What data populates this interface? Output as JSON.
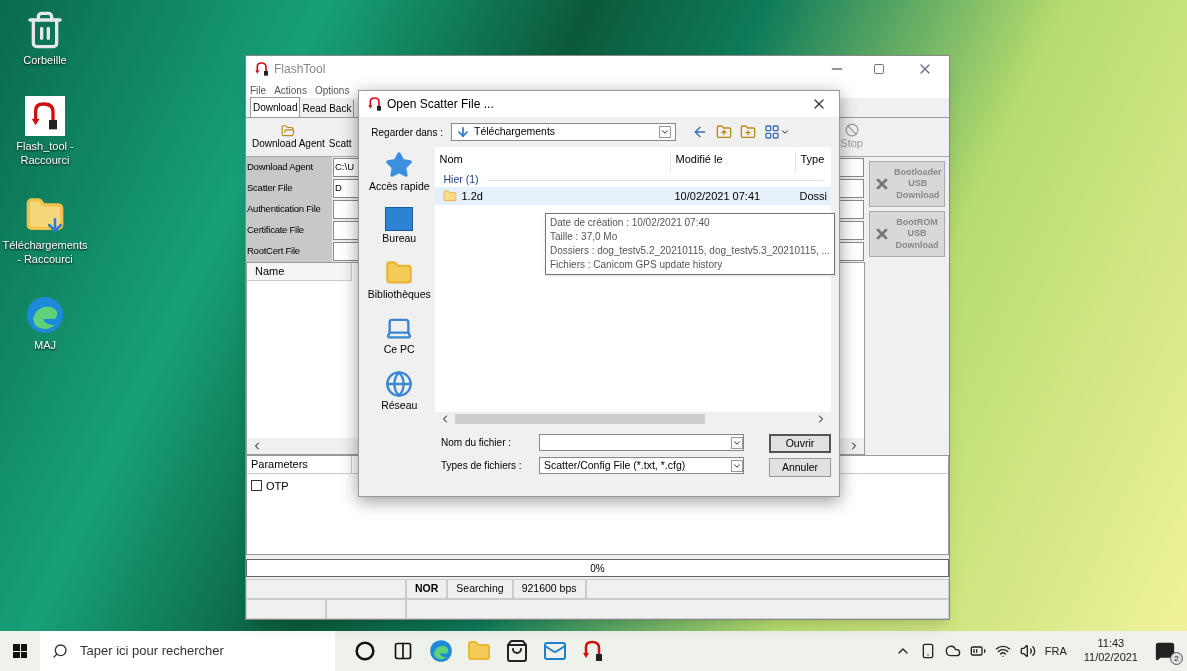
{
  "desktop_icons": [
    {
      "kind": "recycle_bin",
      "label": "Corbeille"
    },
    {
      "kind": "flash",
      "label": "Flash_tool - Raccourci"
    },
    {
      "kind": "downloads",
      "label": "Téléchargements - Raccourci"
    },
    {
      "kind": "edge",
      "label": "MAJ"
    }
  ],
  "flashtool": {
    "title": "FlashTool",
    "menu": [
      "File",
      "Actions",
      "Options"
    ],
    "tabs": [
      {
        "label": "Download",
        "selected": true
      },
      {
        "label": "Read Back",
        "selected": false
      }
    ],
    "toolbar": [
      {
        "kind": "folder",
        "label": "Download Agent"
      },
      {
        "kind": "text",
        "label": "Scatt"
      }
    ],
    "stop_button": "Stop",
    "fields": [
      {
        "label": "Download Agent",
        "value": "C:\\U"
      },
      {
        "label": "Scatter File",
        "value": "D"
      },
      {
        "label": "Authentication File"
      },
      {
        "label": "Certificate File"
      },
      {
        "label": "RootCert File"
      }
    ],
    "list_columns": [
      "Name"
    ],
    "side_buttons": [
      {
        "label": "Bootloader USB Download",
        "disabled": true
      },
      {
        "label": "BootROM USB Download",
        "disabled": true
      }
    ],
    "params_columns": [
      "Parameters"
    ],
    "options": [
      {
        "label": "OTP",
        "checked": false
      }
    ],
    "progress": {
      "level": 0,
      "reading": "0%"
    },
    "status_bar": [
      "NOR",
      "Searching",
      "921600 bps"
    ]
  },
  "dialog": {
    "title": "Open Scatter File ...",
    "look_in_label": "Regarder dans :",
    "look_in_value": "Téléchargements",
    "places": [
      {
        "kind": "quick",
        "label": "Accès rapide"
      },
      {
        "kind": "desktop",
        "label": "Bureau"
      },
      {
        "kind": "libraries",
        "label": "Bibliothèques"
      },
      {
        "kind": "pc",
        "label": "Ce PC"
      },
      {
        "kind": "network",
        "label": "Réseau"
      }
    ],
    "columns": [
      "Nom",
      "Modifié le",
      "Type"
    ],
    "group": "Hier (1)",
    "rows": [
      {
        "name": "1.2d",
        "modified": "10/02/2021 07:41",
        "type": "Dossi",
        "selected": true
      }
    ],
    "filename_label": "Nom du fichier :",
    "filetype_label": "Types de fichiers :",
    "filetype_value": "Scatter/Config File (*.txt, *.cfg)",
    "buttons": [
      "Ouvrir",
      "Annuler"
    ]
  },
  "tooltip": [
    "Date de création : 10/02/2021 07:40",
    "Taille : 37,0 Mo",
    "Dossiers : dog_testv5.2_20210115, dog_testv5.3_20210115, ...",
    "Fichiers : Canicom GPS update history"
  ],
  "taskbar": {
    "search_placeholder": "Taper ici pour rechercher",
    "apps": [
      {
        "kind": "cortana"
      },
      {
        "kind": "taskview"
      },
      {
        "kind": "edge"
      },
      {
        "kind": "explorer"
      },
      {
        "kind": "store"
      },
      {
        "kind": "mail"
      },
      {
        "kind": "flash"
      }
    ],
    "language": "FRA",
    "time": "11:43",
    "date": "11/02/2021",
    "notifications": "2"
  }
}
